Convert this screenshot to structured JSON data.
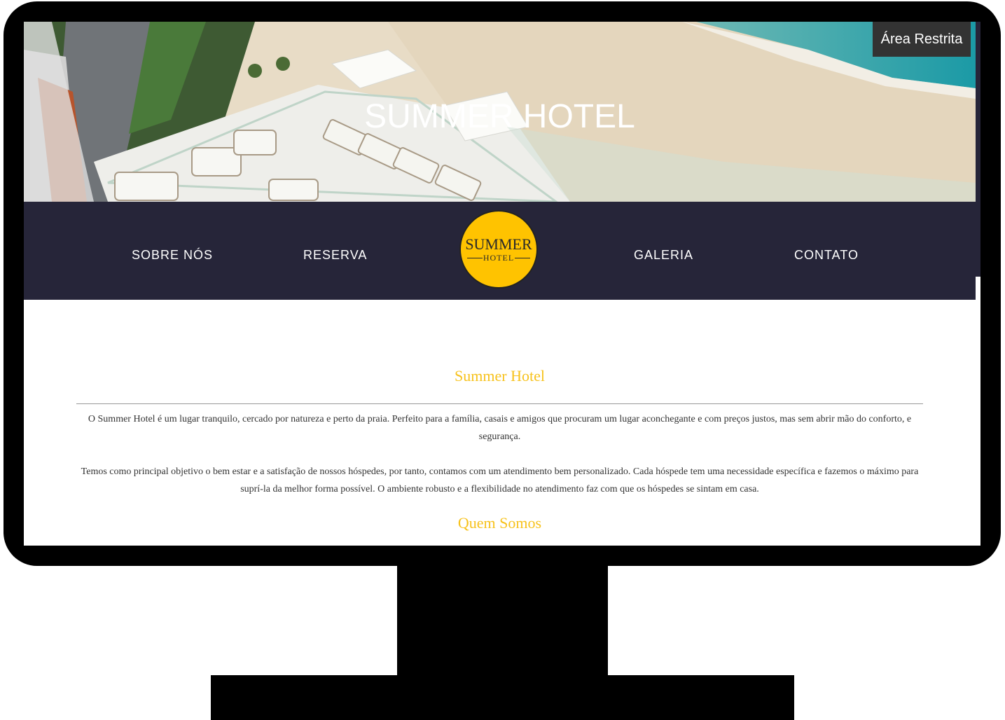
{
  "hero": {
    "title": "SUMMER HOTEL",
    "restricted_area_label": "Área Restrita"
  },
  "nav": {
    "items": [
      {
        "label": "SOBRE NÓS"
      },
      {
        "label": "RESERVA"
      },
      {
        "label": "GALERIA"
      },
      {
        "label": "CONTATO"
      }
    ],
    "logo": {
      "line1": "SUMMER",
      "line2": "HOTEL"
    }
  },
  "content": {
    "heading": "Summer Hotel",
    "paragraph1": "O Summer Hotel é um lugar tranquilo, cercado por natureza e perto da praia.  Perfeito para a família, casais e amigos que procuram um lugar aconchegante e com preços justos, mas sem abrir mão do conforto, e segurança.",
    "paragraph2": "Temos como principal objetivo o bem estar e a satisfação de nossos hóspedes, por tanto, contamos com um atendimento bem personalizado. Cada hóspede tem uma necessidade específica e fazemos o máximo para suprí-la da melhor forma possível. O ambiente robusto e a flexibilidade no atendimento faz com que os hóspedes se sintam em casa.",
    "subheading": "Quem Somos"
  },
  "colors": {
    "nav_bg": "#262539",
    "accent": "#f7c21c",
    "logo_yellow": "#ffc300",
    "monitor_frame": "#000000"
  }
}
